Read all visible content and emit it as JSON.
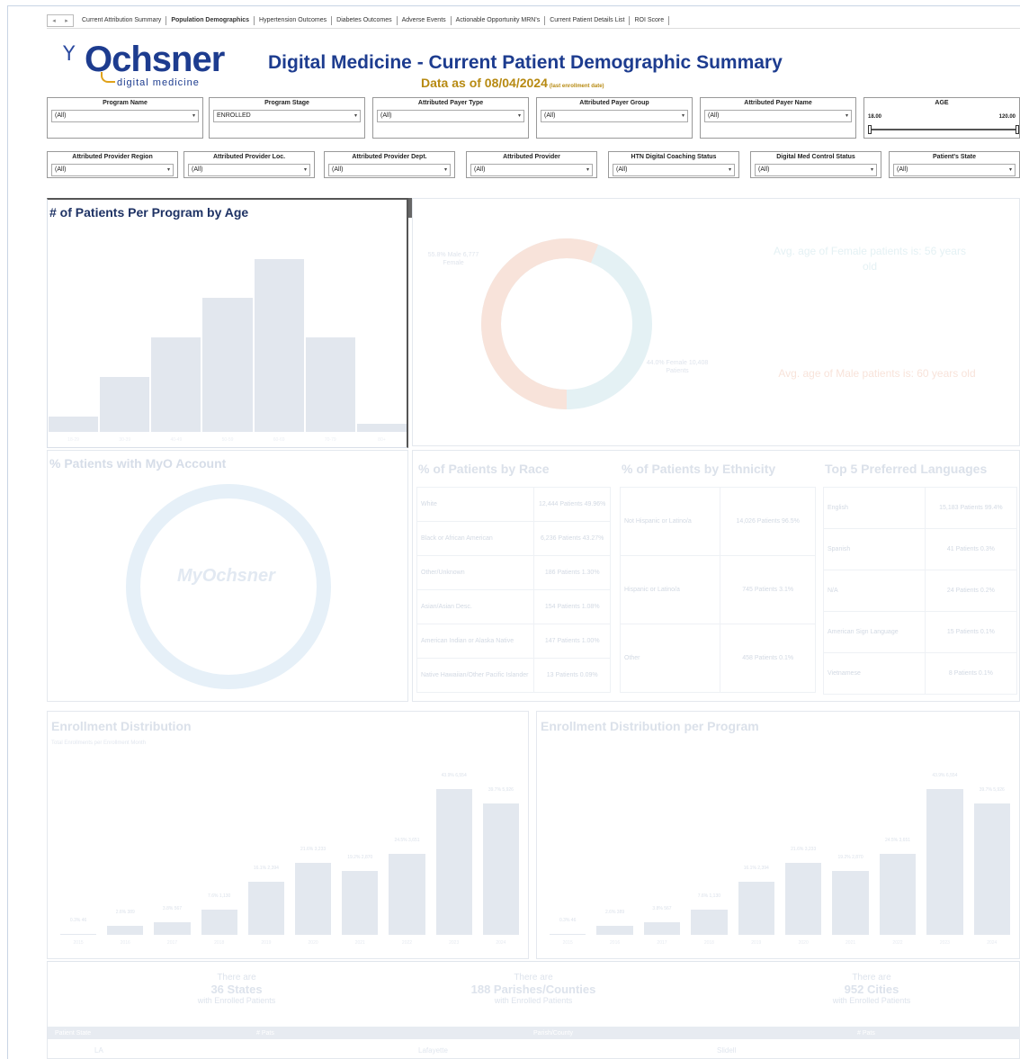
{
  "tabs": [
    "Current Attribution Summary",
    "Population Demographics",
    "Hypertension Outcomes",
    "Diabetes Outcomes",
    "Adverse Events",
    "Actionable Opportunity MRN's",
    "Current Patient Details List",
    "ROI Score"
  ],
  "header": {
    "logo_mark": "Y",
    "logo_name": "Ochsner",
    "logo_sub": "digital medicine",
    "title": "Digital Medicine - Current Patient Demographic Summary",
    "data_as_of": "Data as of 08/04/2024",
    "data_note": "(last enrollment date)"
  },
  "filters_row1": [
    {
      "label": "Program Name",
      "value": "(All)"
    },
    {
      "label": "Program Stage",
      "value": "ENROLLED"
    },
    {
      "label": "Attributed Payer Type",
      "value": "(All)"
    },
    {
      "label": "Attributed Payer Group",
      "value": "(All)"
    },
    {
      "label": "Attributed Payer Name",
      "value": "(All)"
    }
  ],
  "age_filter": {
    "label": "AGE",
    "min": "18.00",
    "max": "120.00",
    "min_marker": "0",
    "max_marker": "0"
  },
  "filters_row2": [
    {
      "label": "Attributed Provider Region",
      "value": "(All)"
    },
    {
      "label": "Attributed Provider Loc.",
      "value": "(All)"
    },
    {
      "label": "Attributed Provider Dept.",
      "value": "(All)"
    },
    {
      "label": "Attributed Provider",
      "value": "(All)"
    },
    {
      "label": "HTN Digital Coaching Status",
      "value": "(All)"
    },
    {
      "label": "Digital Med Control Status",
      "value": "(All)"
    },
    {
      "label": "Patient's State",
      "value": "(All)"
    }
  ],
  "age_chart": {
    "title": "# of Patients Per Program by Age",
    "bar_color": "#e2e7ee"
  },
  "chart_data": {
    "type": "bar",
    "title": "# of Patients Per Program by Age",
    "categories": [
      "18-29",
      "30-39",
      "40-49",
      "50-59",
      "60-69",
      "70-79",
      "80+"
    ],
    "values": [
      2,
      7,
      12,
      17,
      22,
      12,
      1
    ],
    "ylim": [
      0,
      24
    ]
  },
  "gender": {
    "female_label": "55.8% Male 6,777 Female",
    "male_label": "44.0% Female 10,408 Patients",
    "avg_female": "Avg. age of Female patients is: 56 years old",
    "avg_male": "Avg. age of Male patients is: 60 years old",
    "female_color": "#f8e3da",
    "male_color": "#e4f1f4"
  },
  "myo": {
    "title": "% Patients with MyO Account",
    "logo": "MyOchsner",
    "ring_color": "#e6f0f8"
  },
  "race": {
    "title": "% of Patients by Race",
    "rows": [
      {
        "label": "White",
        "value": "12,444 Patients 49.96%"
      },
      {
        "label": "Black or African American",
        "value": "6,236 Patients 43.27%"
      },
      {
        "label": "Other/Unknown",
        "value": "186 Patients 1.30%"
      },
      {
        "label": "Asian/Asian Desc.",
        "value": "154 Patients 1.08%"
      },
      {
        "label": "American Indian or Alaska Native",
        "value": "147 Patients 1.00%"
      },
      {
        "label": "Native Hawaiian/Other Pacific Islander",
        "value": "13 Patients 0.09%"
      }
    ]
  },
  "ethnicity": {
    "title": "% of Patients by Ethnicity",
    "rows": [
      {
        "label": "Not Hispanic or Latino/a",
        "value": "14,026 Patients 96.5%"
      },
      {
        "label": "Hispanic or Latino/a",
        "value": "745 Patients 3.1%"
      },
      {
        "label": "Other",
        "value": "458 Patients 0.1%"
      }
    ]
  },
  "languages": {
    "title": "Top 5 Preferred Languages",
    "rows": [
      {
        "label": "English",
        "value": "15,183 Patients 99.4%"
      },
      {
        "label": "Spanish",
        "value": "41 Patients 0.3%"
      },
      {
        "label": "N/A",
        "value": "24 Patients 0.2%"
      },
      {
        "label": "American Sign Language",
        "value": "15 Patients 0.1%"
      },
      {
        "label": "Vietnamese",
        "value": "8 Patients 0.1%"
      }
    ]
  },
  "enrollment": {
    "title": "Enrollment Distribution",
    "subtitle": "Total Enrollments per Enrollment Month",
    "categories": [
      "2015",
      "2016",
      "2017",
      "2018",
      "2019",
      "2020",
      "2021",
      "2022",
      "2023",
      "2024"
    ],
    "values": [
      0.3,
      2.6,
      3.8,
      7.6,
      16.1,
      21.6,
      19.2,
      24.5,
      43.9,
      39.7
    ],
    "labels": [
      "0.3% 46",
      "2.6% 389",
      "3.8% 567",
      "7.6% 1,130",
      "16.1% 2,394",
      "21.6% 3,233",
      "19.2% 2,870",
      "24.5% 3,651",
      "43.9% 6,554",
      "39.7% 5,926"
    ]
  },
  "enrollment_program": {
    "title": "Enrollment Distribution per Program",
    "categories": [
      "2015",
      "2016",
      "2017",
      "2018",
      "2019",
      "2020",
      "2021",
      "2022",
      "2023",
      "2024"
    ],
    "values": [
      0.3,
      2.6,
      3.8,
      7.6,
      16.1,
      21.6,
      19.2,
      24.5,
      43.9,
      39.7
    ],
    "labels": [
      "0.3% 46",
      "2.6% 389",
      "3.8% 567",
      "7.6% 1,130",
      "16.1% 2,394",
      "21.6% 3,233",
      "19.2% 2,870",
      "24.5% 3,651",
      "43.9% 6,554",
      "39.7% 5,926"
    ]
  },
  "counts": [
    {
      "pre": "There are",
      "value": "36 States",
      "post": "with Enrolled Patients"
    },
    {
      "pre": "There are",
      "value": "188 Parishes/Counties",
      "post": "with Enrolled Patients"
    },
    {
      "pre": "There are",
      "value": "952 Cities",
      "post": "with Enrolled Patients"
    }
  ],
  "count_table": {
    "headers": [
      "Patient State",
      "# Pats",
      "Parish/County",
      "# Pats"
    ],
    "first_row": [
      "LA",
      "Lafayette",
      "Slidell"
    ]
  }
}
